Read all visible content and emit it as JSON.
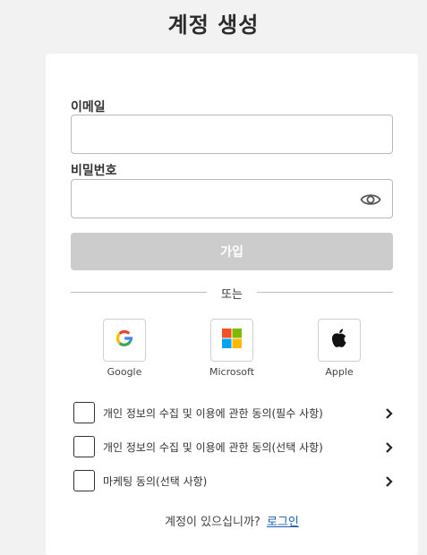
{
  "page": {
    "title": "계정 생성"
  },
  "form": {
    "email": {
      "label": "이메일",
      "value": "",
      "placeholder": ""
    },
    "password": {
      "label": "비밀번호",
      "value": "",
      "placeholder": "",
      "toggle_icon": "eye-icon"
    },
    "submit_label": "가입",
    "submit_enabled": false
  },
  "divider": {
    "text": "또는"
  },
  "social": [
    {
      "label": "Google",
      "icon": "google-logo-icon"
    },
    {
      "label": "Microsoft",
      "icon": "microsoft-logo-icon"
    },
    {
      "label": "Apple",
      "icon": "apple-logo-icon"
    }
  ],
  "consents": [
    {
      "label": "개인 정보의 수집 및 이용에 관한 동의(필수 사항)",
      "checked": false
    },
    {
      "label": "개인 정보의 수집 및 이용에 관한 동의(선택 사항)",
      "checked": false
    },
    {
      "label": "마케팅 동의(선택 사항)",
      "checked": false
    }
  ],
  "footer": {
    "prompt": "계정이 있으십니까?",
    "login_link": "로그인"
  },
  "colors": {
    "background": "#f2f2f2",
    "card": "#ffffff",
    "button_disabled": "#cccccc",
    "link": "#1a5fb4"
  }
}
